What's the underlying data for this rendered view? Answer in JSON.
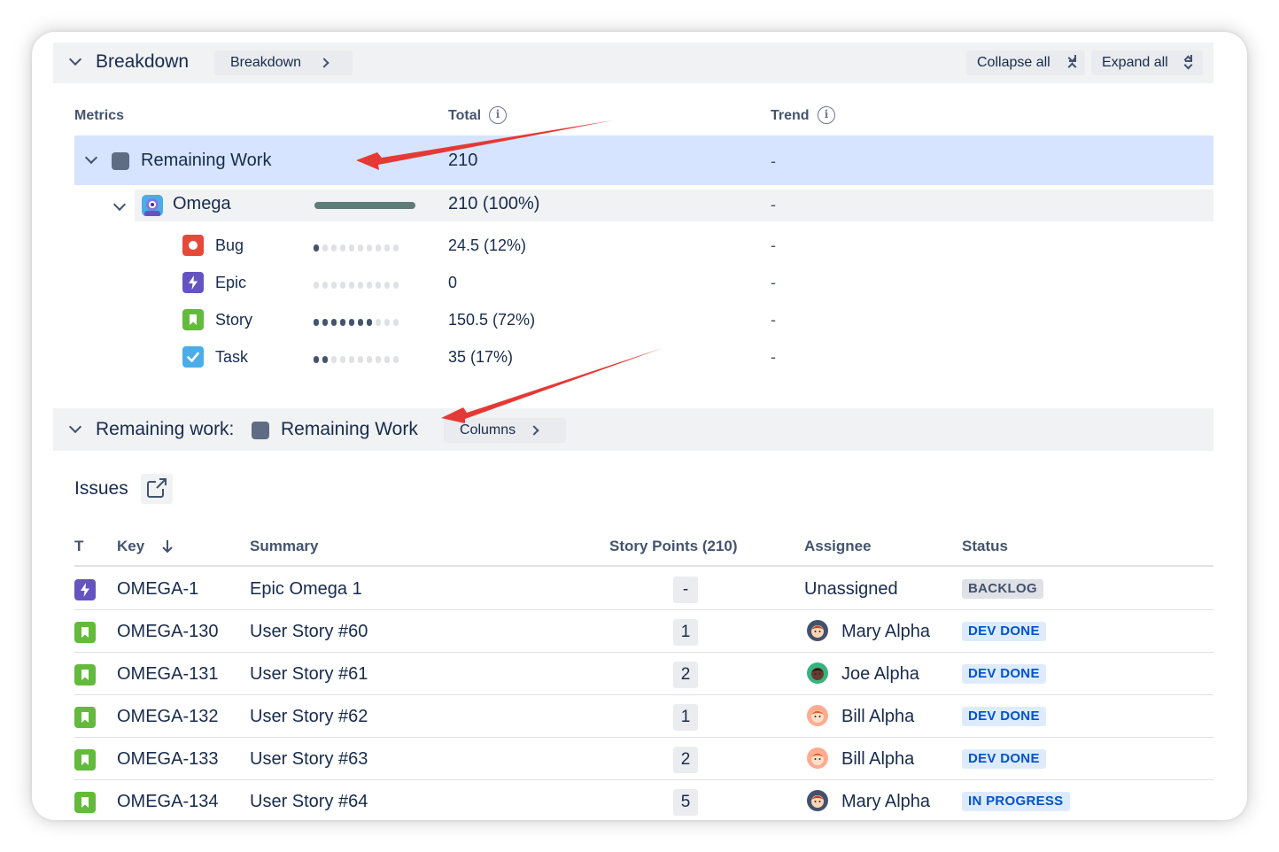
{
  "breakdown": {
    "title": "Breakdown",
    "view_button": "Breakdown",
    "collapse_all": "Collapse all",
    "expand_all": "Expand all"
  },
  "metrics_table": {
    "headers": {
      "metrics": "Metrics",
      "total": "Total",
      "trend": "Trend"
    },
    "remaining_row": {
      "label": "Remaining Work",
      "total": "210",
      "trend": "-"
    },
    "project_row": {
      "label": "Omega",
      "total": "210 (100%)",
      "trend": "-",
      "progress": 1.0
    },
    "types": [
      {
        "label": "Bug",
        "total": "24.5 (12%)",
        "trend": "-",
        "dots_on": 1,
        "icon": "bug-icon",
        "color": "#e5493a"
      },
      {
        "label": "Epic",
        "total": "0",
        "trend": "-",
        "dots_on": 0,
        "icon": "epic-icon",
        "color": "#6554c0"
      },
      {
        "label": "Story",
        "total": "150.5 (72%)",
        "trend": "-",
        "dots_on": 7,
        "icon": "story-icon",
        "color": "#63ba3c"
      },
      {
        "label": "Task",
        "total": "35 (17%)",
        "trend": "-",
        "dots_on": 2,
        "icon": "task-icon",
        "color": "#4bade8"
      }
    ]
  },
  "remaining_section": {
    "prefix": "Remaining work:",
    "label": "Remaining Work",
    "columns_button": "Columns"
  },
  "issues": {
    "title": "Issues",
    "headers": {
      "t": "T",
      "key": "Key",
      "summary": "Summary",
      "points": "Story Points (210)",
      "assignee": "Assignee",
      "status": "Status"
    },
    "rows": [
      {
        "type": "epic",
        "key": "OMEGA-1",
        "summary": "Epic Omega 1",
        "points": "-",
        "assignee": "Unassigned",
        "status": "BACKLOG",
        "status_style": "gray",
        "avatar": ""
      },
      {
        "type": "story",
        "key": "OMEGA-130",
        "summary": "User Story #60",
        "points": "1",
        "assignee": "Mary Alpha",
        "status": "DEV DONE",
        "status_style": "blue",
        "avatar": "mary"
      },
      {
        "type": "story",
        "key": "OMEGA-131",
        "summary": "User Story #61",
        "points": "2",
        "assignee": "Joe Alpha",
        "status": "DEV DONE",
        "status_style": "blue",
        "avatar": "joe"
      },
      {
        "type": "story",
        "key": "OMEGA-132",
        "summary": "User Story #62",
        "points": "1",
        "assignee": "Bill Alpha",
        "status": "DEV DONE",
        "status_style": "blue",
        "avatar": "bill"
      },
      {
        "type": "story",
        "key": "OMEGA-133",
        "summary": "User Story #63",
        "points": "2",
        "assignee": "Bill Alpha",
        "status": "DEV DONE",
        "status_style": "blue",
        "avatar": "bill"
      },
      {
        "type": "story",
        "key": "OMEGA-134",
        "summary": "User Story #64",
        "points": "5",
        "assignee": "Mary Alpha",
        "status": "IN PROGRESS",
        "status_style": "blue",
        "avatar": "mary"
      }
    ]
  },
  "colors": {
    "highlight_row": "#d6e4ff",
    "section_bar": "#f1f2f4",
    "annotation_arrow": "#e53935"
  }
}
